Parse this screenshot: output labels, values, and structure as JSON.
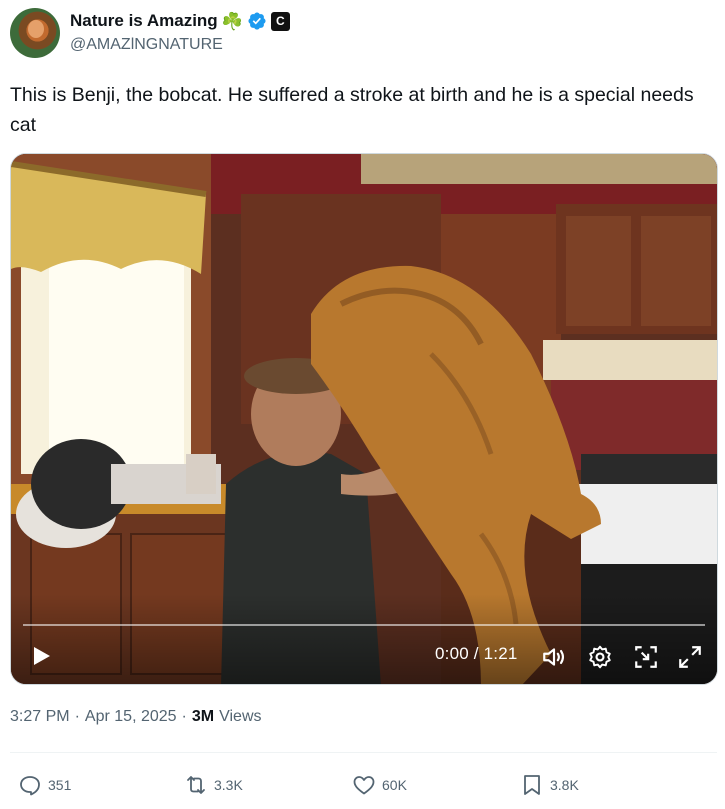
{
  "author": {
    "name": "Nature is Amazing",
    "emoji": "☘️",
    "handle": "@AMAZlNGNATURE",
    "affiliate_badge": "C",
    "verified_color": "#1d9bf0"
  },
  "tweet": {
    "text": "This is Benji, the bobcat. He suffered a stroke at birth and he is a special needs cat"
  },
  "video": {
    "time": "0:00 / 1:21",
    "progress": 0,
    "icons": [
      "play-icon",
      "volume-icon",
      "settings-icon",
      "pip-icon",
      "fullscreen-icon"
    ]
  },
  "meta": {
    "time": "3:27 PM",
    "separator": "·",
    "date": "Apr 15, 2025",
    "views_count": "3M",
    "views_label": "Views"
  },
  "actions": {
    "replies": "351",
    "reposts": "3.3K",
    "likes": "60K",
    "bookmarks": "3.8K"
  },
  "colors": {
    "text": "#0f1419",
    "secondary": "#536471",
    "divider": "#eff3f4"
  }
}
